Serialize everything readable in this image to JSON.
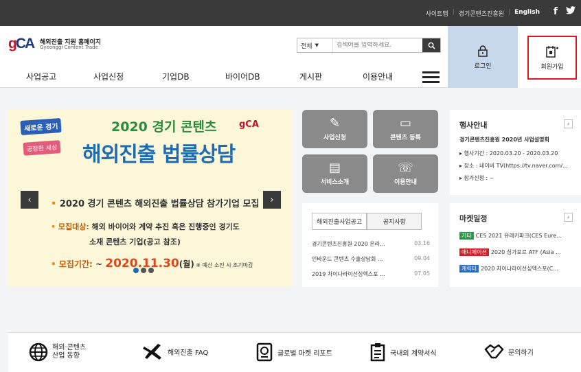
{
  "topbar": {
    "links": [
      "사이트맵",
      "경기콘텐츠진흥원",
      "English"
    ],
    "sns": [
      "f",
      "🐦"
    ]
  },
  "logo": {
    "title": "해외진출 지원 홈페이지",
    "subtitle": "Gyeonggi Content Trade"
  },
  "search": {
    "category": "전체",
    "placeholder": "검색어를 입력하세요."
  },
  "nav": [
    "사업공고",
    "사업신청",
    "기업DB",
    "바이어DB",
    "게시판",
    "이용안내"
  ],
  "account": {
    "login": "로그인",
    "join": "회원가입"
  },
  "banner": {
    "tag1": "새로운 경기",
    "tag2": "공정한 세상",
    "year": "2020 경기 콘텐츠",
    "headline": "해외진출 법률상담",
    "line1": "2020 경기 콘텐츠 해외진출 법률상담 참가기업 모집",
    "line2_label": "모집대상:",
    "line2": " 해외 바이어와 계약 추진 혹은 진행중인 경기도",
    "line3": "소재 콘텐츠 기업(공고 참조)",
    "line4_label": "모집기간:",
    "line4_prefix": " ~ ",
    "line4_date": "2020.11.30",
    "line4_day": "(월)",
    "line4_note": " ※ 예산 소진 시 조기마감"
  },
  "tiles": [
    {
      "label": "사업신청",
      "icon": "edit-icon"
    },
    {
      "label": "콘텐츠 등록",
      "icon": "monitor-icon"
    },
    {
      "label": "서비스소개",
      "icon": "card-icon"
    },
    {
      "label": "이용안내",
      "icon": "phone-icon"
    }
  ],
  "notice": {
    "tabs": [
      "해외진출사업공고",
      "공지사항"
    ],
    "rows": [
      {
        "title": "경기콘텐츠진흥원 2020 온라...",
        "date": "03.16"
      },
      {
        "title": "인바운드 콘텐츠 수출상담회 ...",
        "date": "09.04"
      },
      {
        "title": "2019 차이나라이선싱엑스포 ...",
        "date": "07.05"
      }
    ]
  },
  "events": {
    "title": "행사안내",
    "heading": "경기콘텐츠진흥원 2020년 사업설명회",
    "lines": [
      "▸ 행사기간 : 2020.03.20 - 2020.03.20",
      "▸ 장소 : 네이버 TV(https://tv.naver.com/...",
      "▸ 참가신청 : ~"
    ]
  },
  "market": {
    "title": "마켓일정",
    "items": [
      {
        "badge": "기타",
        "color": "#2c9a4a",
        "text": "CES 2021 유레카파크(CES Eure..."
      },
      {
        "badge": "애니메이션",
        "color": "#d21f2a",
        "text": "2020 싱가포르 ATF (Asia ..."
      },
      {
        "badge": "캐릭터",
        "color": "#2a6fc6",
        "text": "2020 차이나라이선싱엑스포(C..."
      }
    ]
  },
  "bottom": [
    {
      "label": "해외·콘텐츠\n산업 동향",
      "icon": "globe-icon"
    },
    {
      "label": "해외진출 FAQ",
      "icon": "airplane-icon"
    },
    {
      "label": "글로벌 마켓 리포트",
      "icon": "passport-icon"
    },
    {
      "label": "국내외 계약서식",
      "icon": "clipboard-icon"
    },
    {
      "label": "문의하기",
      "icon": "handshake-icon"
    }
  ]
}
